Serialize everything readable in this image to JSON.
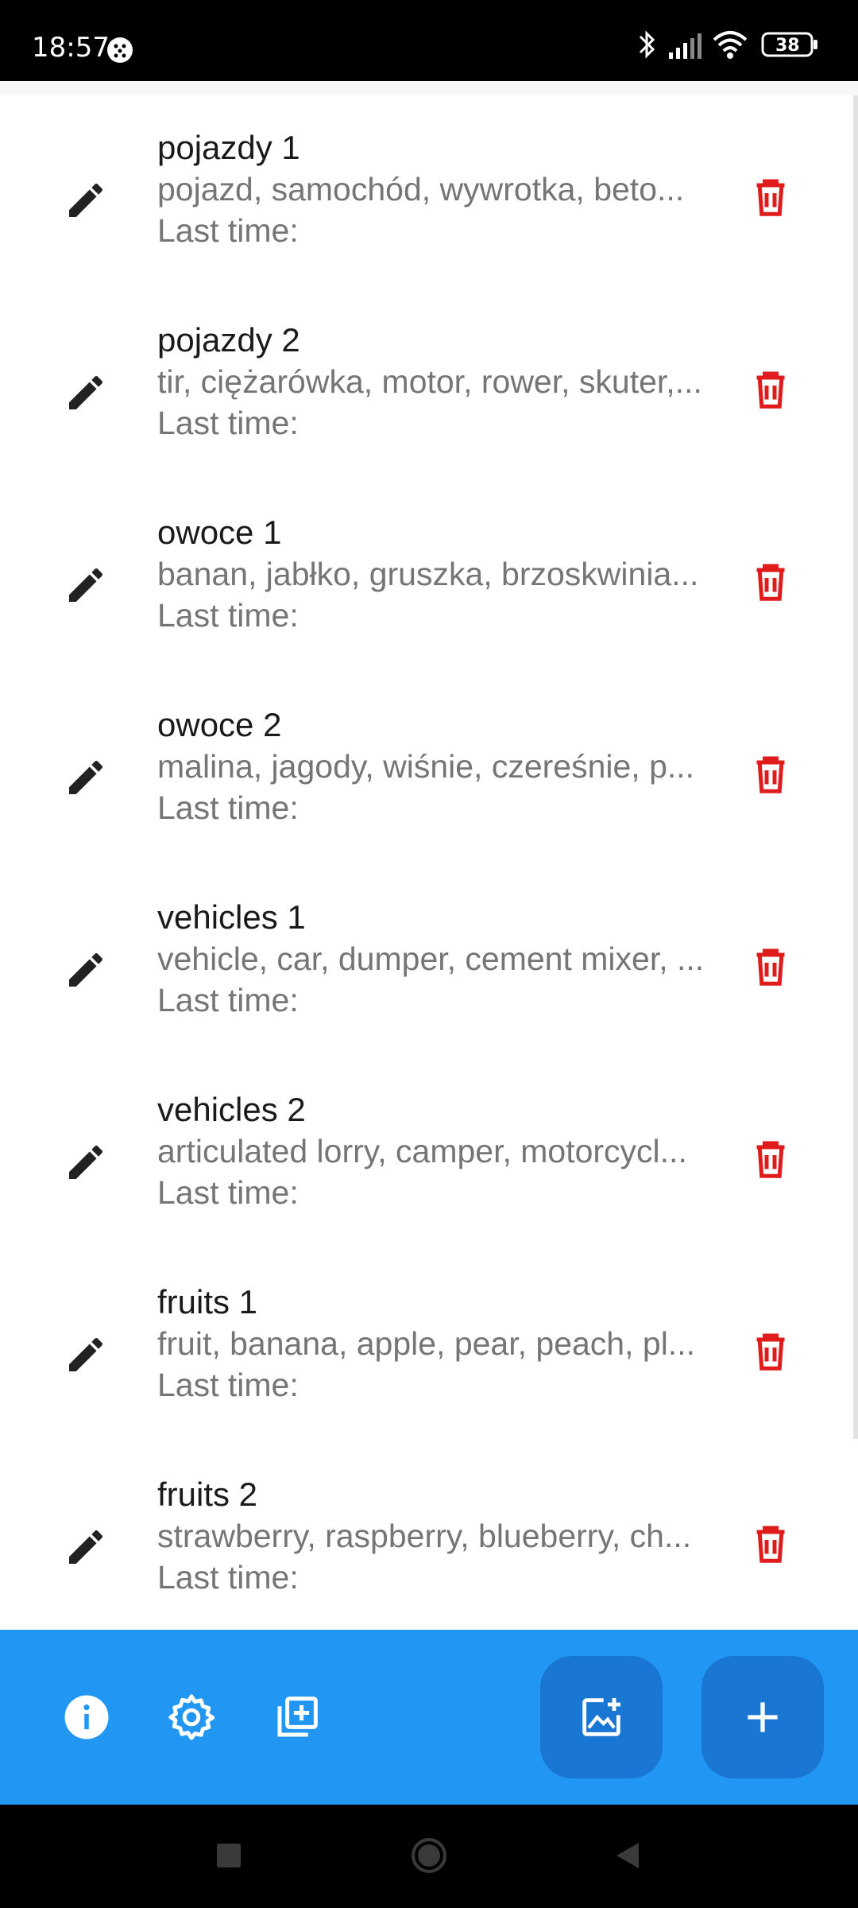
{
  "status_bar": {
    "time": "18:57",
    "battery": "38"
  },
  "list": {
    "items": [
      {
        "title": "pojazdy 1",
        "words": "pojazd, samochód, wywrotka, beto...",
        "last_time": "Last time:"
      },
      {
        "title": "pojazdy 2",
        "words": "tir, ciężarówka, motor, rower, skuter,...",
        "last_time": "Last time:"
      },
      {
        "title": "owoce 1",
        "words": "banan, jabłko, gruszka, brzoskwinia...",
        "last_time": "Last time:"
      },
      {
        "title": "owoce 2",
        "words": "malina, jagody, wiśnie, czereśnie, p...",
        "last_time": "Last time:"
      },
      {
        "title": "vehicles 1",
        "words": "vehicle, car, dumper, cement mixer, ...",
        "last_time": "Last time:"
      },
      {
        "title": "vehicles 2",
        "words": "articulated lorry, camper, motorcycl...",
        "last_time": "Last time:"
      },
      {
        "title": "fruits 1",
        "words": "fruit, banana, apple, pear, peach, pl...",
        "last_time": "Last time:"
      },
      {
        "title": "fruits 2",
        "words": "strawberry, raspberry, blueberry, ch...",
        "last_time": "Last time:"
      }
    ]
  },
  "bottom_bar": {
    "icons": [
      "info-icon",
      "gear-icon",
      "add-to-library-icon"
    ],
    "fabs": [
      "add-photo-icon",
      "plus-icon"
    ]
  },
  "colors": {
    "accent": "#2196f3",
    "fab": "#1976d2",
    "delete": "#e01b1b",
    "edit": "#222222"
  }
}
